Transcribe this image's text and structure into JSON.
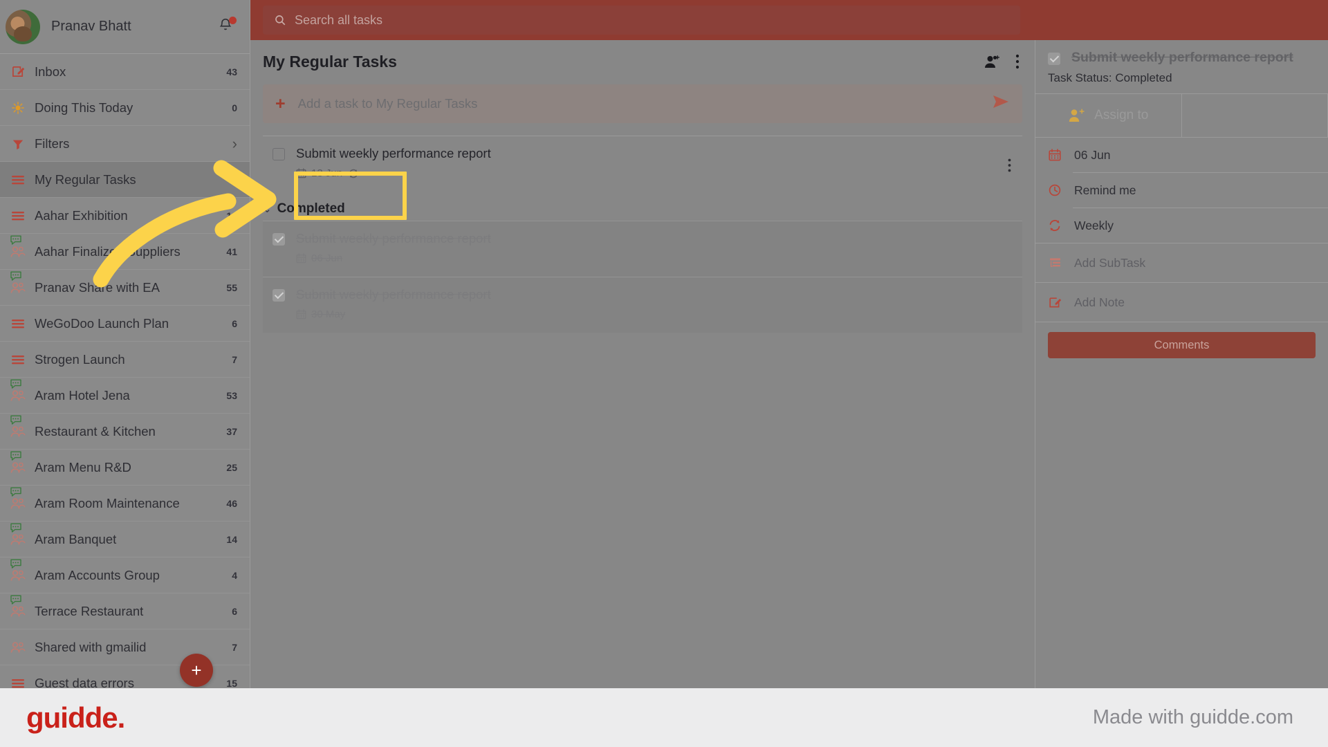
{
  "user": {
    "name": "Pranav Bhatt",
    "avatar": "user-avatar",
    "bell": "notification-bell-icon"
  },
  "search": {
    "placeholder": "Search all tasks",
    "icon": "search-icon"
  },
  "sidebar": {
    "items": [
      {
        "label": "Inbox",
        "count": "43",
        "icon": "inbox-edit-icon",
        "type": "count",
        "bubble": false,
        "active": false
      },
      {
        "label": "Doing This Today",
        "count": "0",
        "icon": "sun-icon",
        "type": "count",
        "bubble": false,
        "active": false
      },
      {
        "label": "Filters",
        "count": "",
        "icon": "funnel-icon",
        "type": "chevron",
        "bubble": false,
        "active": false
      },
      {
        "label": "My Regular Tasks",
        "count": "",
        "icon": "list-icon",
        "type": "count",
        "bubble": false,
        "active": true
      },
      {
        "label": "Aahar Exhibition",
        "count": "16",
        "icon": "list-icon",
        "type": "count",
        "bubble": false,
        "active": false
      },
      {
        "label": "Aahar Finalized Suppliers",
        "count": "41",
        "icon": "group-icon",
        "type": "count",
        "bubble": true,
        "active": false
      },
      {
        "label": "Pranav Share with EA",
        "count": "55",
        "icon": "group-icon",
        "type": "count",
        "bubble": true,
        "active": false
      },
      {
        "label": "WeGoDoo Launch Plan",
        "count": "6",
        "icon": "list-icon",
        "type": "count",
        "bubble": false,
        "active": false
      },
      {
        "label": "Strogen Launch",
        "count": "7",
        "icon": "list-icon",
        "type": "count",
        "bubble": false,
        "active": false
      },
      {
        "label": "Aram Hotel Jena",
        "count": "53",
        "icon": "group-icon",
        "type": "count",
        "bubble": true,
        "active": false
      },
      {
        "label": "Restaurant & Kitchen",
        "count": "37",
        "icon": "group-icon",
        "type": "count",
        "bubble": true,
        "active": false
      },
      {
        "label": "Aram Menu R&D",
        "count": "25",
        "icon": "group-icon",
        "type": "count",
        "bubble": true,
        "active": false
      },
      {
        "label": "Aram Room Maintenance",
        "count": "46",
        "icon": "group-icon",
        "type": "count",
        "bubble": true,
        "active": false
      },
      {
        "label": "Aram Banquet",
        "count": "14",
        "icon": "group-icon",
        "type": "count",
        "bubble": true,
        "active": false
      },
      {
        "label": "Aram Accounts Group",
        "count": "4",
        "icon": "group-icon",
        "type": "count",
        "bubble": true,
        "active": false
      },
      {
        "label": "Terrace Restaurant",
        "count": "6",
        "icon": "group-icon",
        "type": "count",
        "bubble": true,
        "active": false
      },
      {
        "label": "Shared with gmailid",
        "count": "7",
        "icon": "group-icon",
        "type": "count",
        "bubble": false,
        "active": false
      },
      {
        "label": "Guest data errors",
        "count": "15",
        "icon": "list-icon",
        "type": "count",
        "bubble": false,
        "active": false
      }
    ],
    "fab_label": "+"
  },
  "main": {
    "title": "My Regular Tasks",
    "add_members_icon": "add-members-icon",
    "more_icon": "more-vertical-icon",
    "add_task_placeholder": "Add a task to My Regular Tasks",
    "add_task_plus": "+",
    "send_icon": "send-icon",
    "open_tasks": [
      {
        "title": "Submit weekly performance report",
        "date": "13 Jun",
        "repeat": true,
        "checked": false
      }
    ],
    "completed_section_label": "Completed",
    "completed_caret": "⌄",
    "completed_tasks": [
      {
        "title": "Submit weekly performance report",
        "date": "06 Jun",
        "repeat": false,
        "checked": true
      },
      {
        "title": "Submit weekly performance report",
        "date": "30 May",
        "repeat": false,
        "checked": true
      }
    ]
  },
  "detail": {
    "title": "Submit weekly performance report",
    "status": "Task Status: Completed",
    "assign_label": "Assign to",
    "assign_icon": "assign-user-icon",
    "rows": [
      {
        "label": "06 Jun",
        "icon": "calendar-icon"
      },
      {
        "label": "Remind me",
        "icon": "clock-icon"
      },
      {
        "label": "Weekly",
        "icon": "repeat-icon"
      },
      {
        "label": "Add SubTask",
        "icon": "subtask-icon"
      },
      {
        "label": "Add Note",
        "icon": "note-edit-icon"
      }
    ],
    "comments_label": "Comments"
  },
  "footer": {
    "brand": "guidde.",
    "made_with": "Made with guidde.com"
  },
  "colors": {
    "accent": "#9e3d2f",
    "highlight": "#FCD34A",
    "brand": "#C9211A",
    "topbar": "#8f3b31"
  }
}
